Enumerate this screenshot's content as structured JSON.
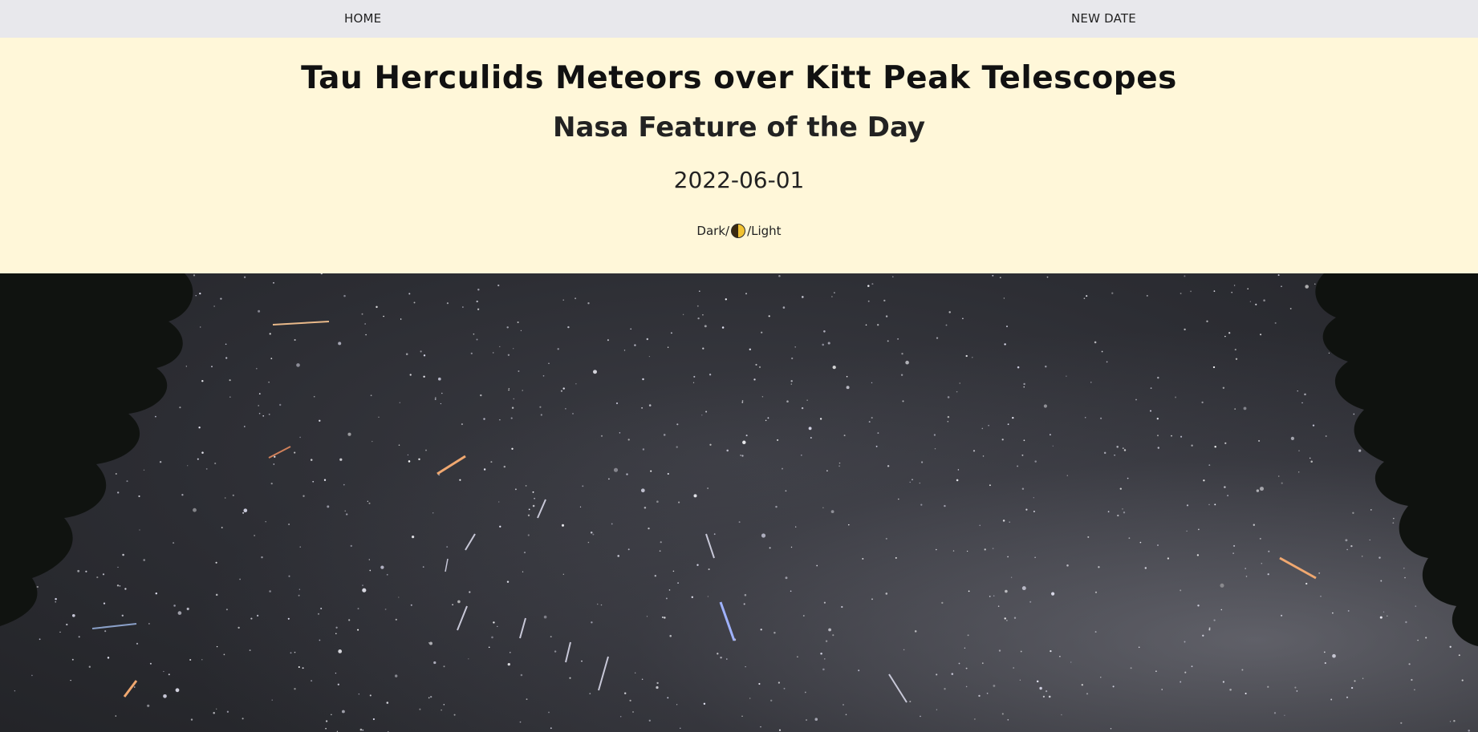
{
  "nav": {
    "home_label": "HOME",
    "new_date_label": "NEW DATE"
  },
  "header": {
    "title": "Tau Herculids Meteors over Kitt Peak Telescopes",
    "subtitle": "Nasa Feature of the Day",
    "date": "2022-06-01"
  },
  "theme_toggle": {
    "dark_label": "Dark/",
    "light_label": "/Light",
    "icon": "half-moon-icon"
  },
  "colors": {
    "nav_bg": "#e8e8ec",
    "header_bg": "#fff7d9",
    "sky": "#2c2d33"
  },
  "image": {
    "subject": "night-sky-meteors-photo"
  }
}
